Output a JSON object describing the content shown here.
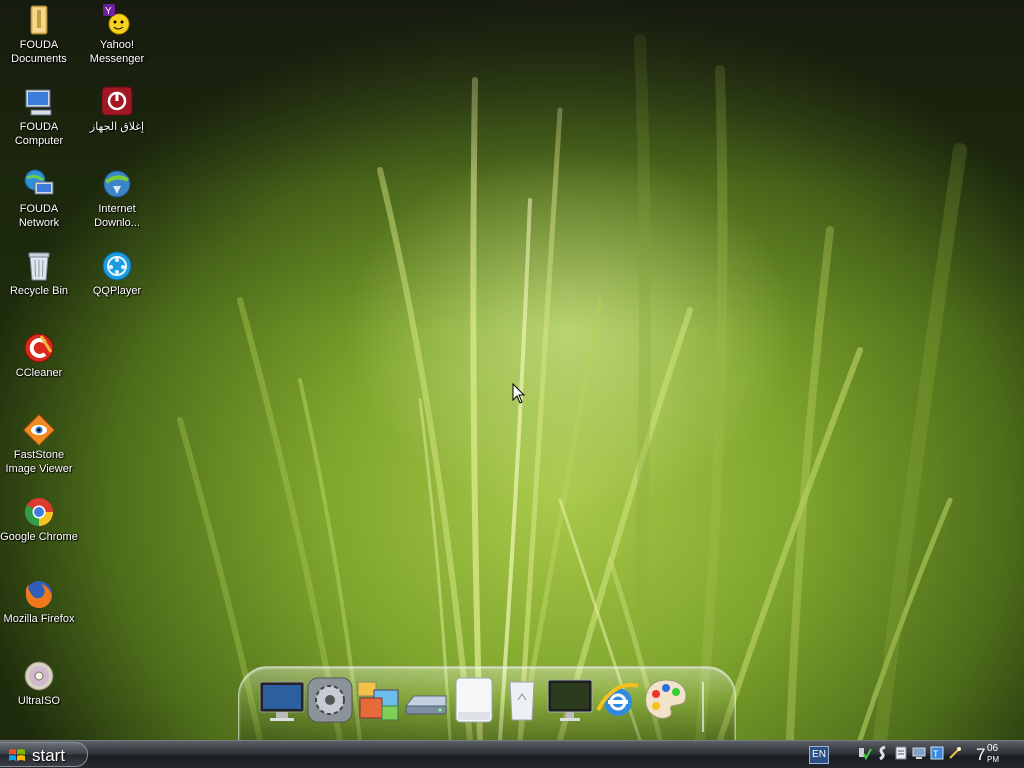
{
  "desktop": {
    "icons": [
      {
        "label": "FOUDA\nDocuments",
        "icon": "folder-icon"
      },
      {
        "label": "Yahoo!\nMessenger",
        "icon": "yahoo-messenger-icon"
      },
      {
        "label": "FOUDA\nComputer",
        "icon": "computer-icon"
      },
      {
        "label": "إغلاق الجهاز",
        "icon": "shutdown-icon"
      },
      {
        "label": "FOUDA\nNetwork",
        "icon": "network-icon"
      },
      {
        "label": "Internet\nDownlo...",
        "icon": "internet-download-manager-icon"
      },
      {
        "label": "Recycle Bin",
        "icon": "recycle-bin-icon"
      },
      {
        "label": "QQPlayer",
        "icon": "qqplayer-icon"
      },
      {
        "label": "CCleaner",
        "icon": "ccleaner-icon"
      },
      {
        "label": "FastStone\nImage Viewer",
        "icon": "faststone-icon"
      },
      {
        "label": "Google Chrome",
        "icon": "chrome-icon"
      },
      {
        "label": "Mozilla Firefox",
        "icon": "firefox-icon"
      },
      {
        "label": "UltraISO",
        "icon": "ultraiso-icon"
      }
    ]
  },
  "dock": {
    "items": [
      "monitor-icon",
      "settings-gear-icon",
      "photo-gallery-icon",
      "drive-icon",
      "removable-drive-icon",
      "trash-icon",
      "display-icon",
      "internet-explorer-icon",
      "paint-palette-icon"
    ]
  },
  "taskbar": {
    "start_label": "start",
    "language": "EN",
    "tray_icons": [
      "network-tray-icon",
      "safety-tray-icon",
      "notes-tray-icon",
      "display-tray-icon",
      "keyboard-tray-icon",
      "magic-tray-icon"
    ],
    "clock": {
      "hour": "7",
      "minute": "06",
      "ampm": "PM"
    }
  },
  "colors": {
    "taskbar": "#25282d",
    "wallpaper_green": "#7ea52c",
    "label_text": "#ffffff"
  }
}
